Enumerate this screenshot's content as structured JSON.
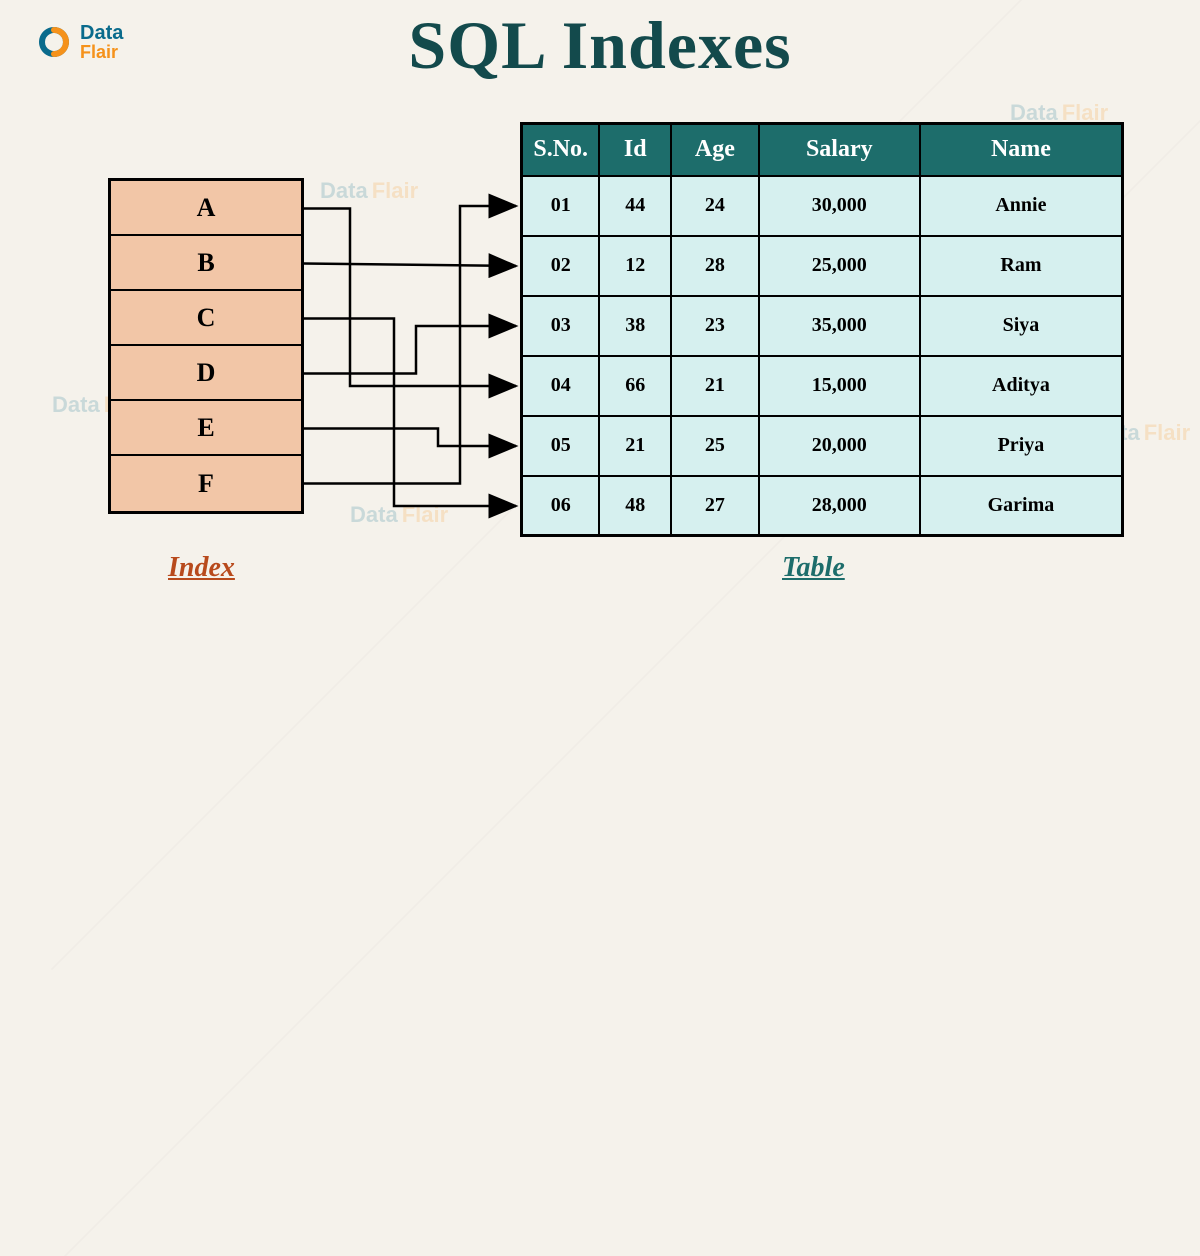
{
  "brand": {
    "line1": "Data",
    "line2": "Flair"
  },
  "title": "SQL Indexes",
  "index": {
    "caption": "Index",
    "items": [
      "A",
      "B",
      "C",
      "D",
      "E",
      "F"
    ]
  },
  "table": {
    "caption": "Table",
    "headers": {
      "sno": "S.No.",
      "id": "Id",
      "age": "Age",
      "salary": "Salary",
      "name": "Name"
    },
    "rows": [
      {
        "sno": "01",
        "id": "44",
        "age": "24",
        "salary": "30,000",
        "name": "Annie"
      },
      {
        "sno": "02",
        "id": "12",
        "age": "28",
        "salary": "25,000",
        "name": "Ram"
      },
      {
        "sno": "03",
        "id": "38",
        "age": "23",
        "salary": "35,000",
        "name": "Siya"
      },
      {
        "sno": "04",
        "id": "66",
        "age": "21",
        "salary": "15,000",
        "name": "Aditya"
      },
      {
        "sno": "05",
        "id": "21",
        "age": "25",
        "salary": "20,000",
        "name": "Priya"
      },
      {
        "sno": "06",
        "id": "48",
        "age": "27",
        "salary": "28,000",
        "name": "Garima"
      }
    ]
  },
  "mappings": [
    {
      "from": 0,
      "to": 3
    },
    {
      "from": 1,
      "to": 1
    },
    {
      "from": 2,
      "to": 5
    },
    {
      "from": 3,
      "to": 2
    },
    {
      "from": 4,
      "to": 4
    },
    {
      "from": 5,
      "to": 0
    }
  ]
}
